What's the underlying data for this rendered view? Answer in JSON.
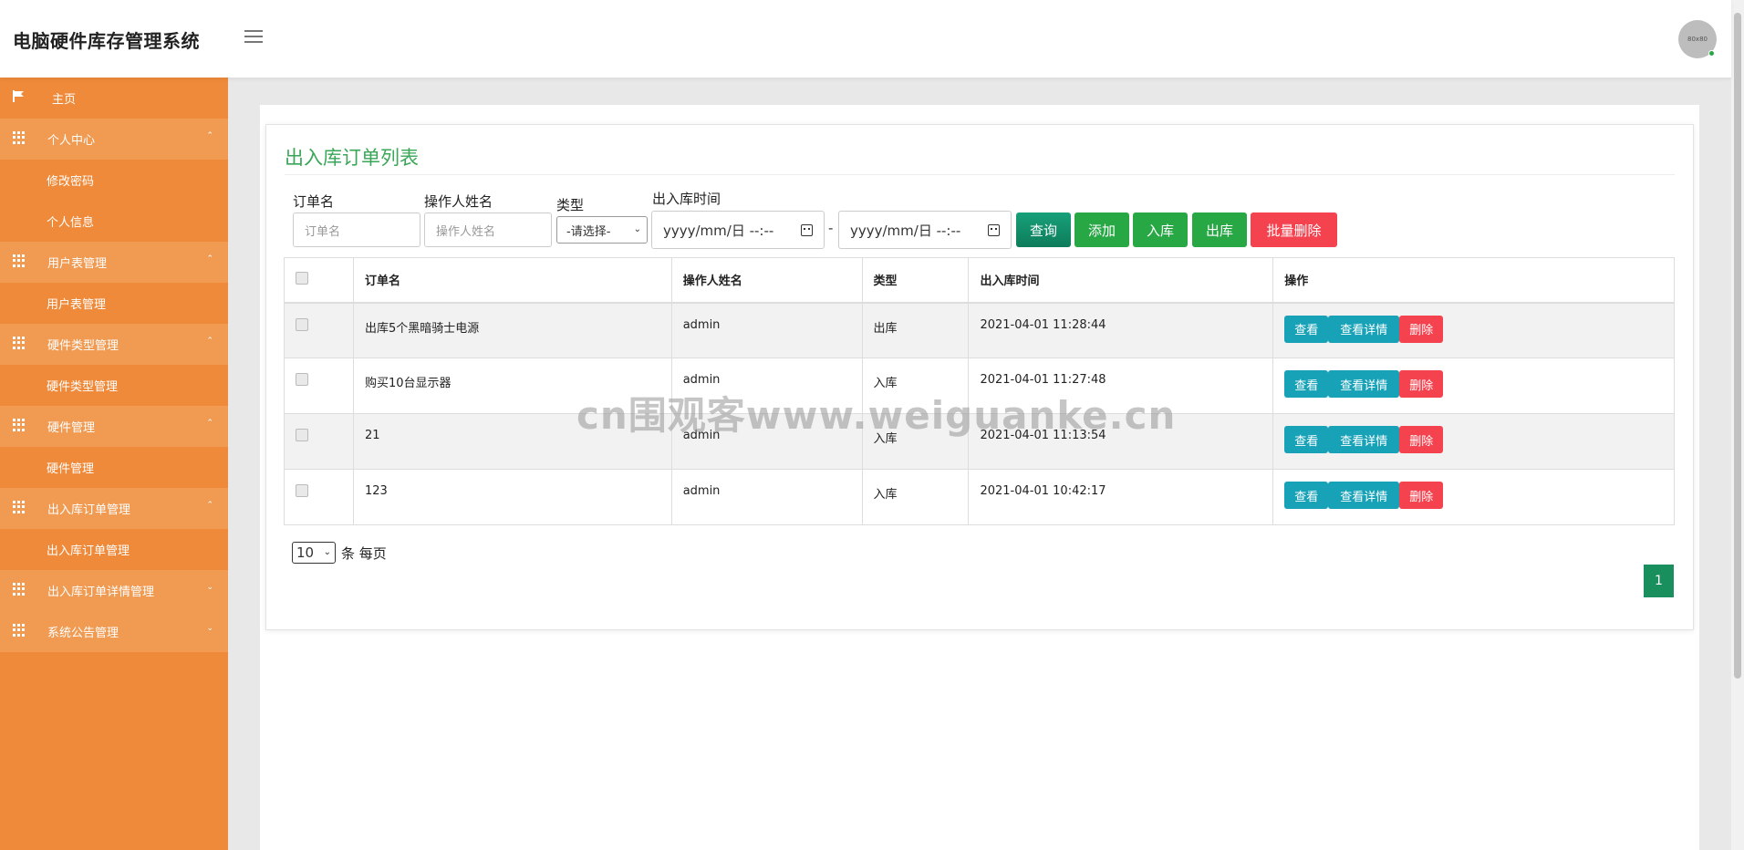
{
  "header": {
    "title": "电脑硬件库存管理系统",
    "avatar_text": "80x80"
  },
  "sidebar": {
    "items": [
      {
        "label": "主页",
        "type": "home"
      },
      {
        "label": "个人中心",
        "type": "group",
        "arrow": "⌃"
      },
      {
        "label": "修改密码",
        "type": "sub"
      },
      {
        "label": "个人信息",
        "type": "sub"
      },
      {
        "label": "用户表管理",
        "type": "group",
        "arrow": "⌃"
      },
      {
        "label": "用户表管理",
        "type": "sub"
      },
      {
        "label": "硬件类型管理",
        "type": "group",
        "arrow": "⌃"
      },
      {
        "label": "硬件类型管理",
        "type": "sub"
      },
      {
        "label": "硬件管理",
        "type": "group",
        "arrow": "⌃"
      },
      {
        "label": "硬件管理",
        "type": "sub"
      },
      {
        "label": "出入库订单管理",
        "type": "group",
        "arrow": "⌃"
      },
      {
        "label": "出入库订单管理",
        "type": "sub"
      },
      {
        "label": "出入库订单详情管理",
        "type": "group",
        "arrow": "⌄"
      },
      {
        "label": "系统公告管理",
        "type": "group",
        "arrow": "⌄"
      }
    ]
  },
  "main": {
    "title": "出入库订单列表",
    "filters": {
      "order_name_label": "订单名",
      "order_name_placeholder": "订单名",
      "operator_label": "操作人姓名",
      "operator_placeholder": "操作人姓名",
      "type_label": "类型",
      "type_selected": "-请选择-",
      "time_label": "出入库时间",
      "date_start_placeholder": "yyyy/mm/日 --:--",
      "date_end_placeholder": "yyyy/mm/日 --:--",
      "date_separator": "-"
    },
    "buttons": {
      "query": "查询",
      "add": "添加",
      "in": "入库",
      "out": "出库",
      "batch_delete": "批量删除"
    },
    "table": {
      "columns": [
        "订单名",
        "操作人姓名",
        "类型",
        "出入库时间",
        "操作"
      ],
      "rows": [
        {
          "name": "出库5个黑暗骑士电源",
          "operator": "admin",
          "type": "出库",
          "time": "2021-04-01 11:28:44"
        },
        {
          "name": "购买10台显示器",
          "operator": "admin",
          "type": "入库",
          "time": "2021-04-01 11:27:48"
        },
        {
          "name": "21",
          "operator": "admin",
          "type": "入库",
          "time": "2021-04-01 11:13:54"
        },
        {
          "name": "123",
          "operator": "admin",
          "type": "入库",
          "time": "2021-04-01 10:42:17"
        }
      ],
      "actions": {
        "view": "查看",
        "detail": "查看详情",
        "delete": "删除"
      }
    },
    "pagination": {
      "page_size": "10",
      "page_size_suffix": "条 每页",
      "current_page": "1"
    }
  },
  "watermark": "cn围观客www.weiguanke.cn",
  "colors": {
    "sidebar": "#ef8a3a",
    "sidebar_group": "#f09a52",
    "title_green": "#3aa657",
    "btn_green": "#28a745",
    "btn_red": "#f4424f",
    "btn_cyan": "#17a2b8"
  }
}
